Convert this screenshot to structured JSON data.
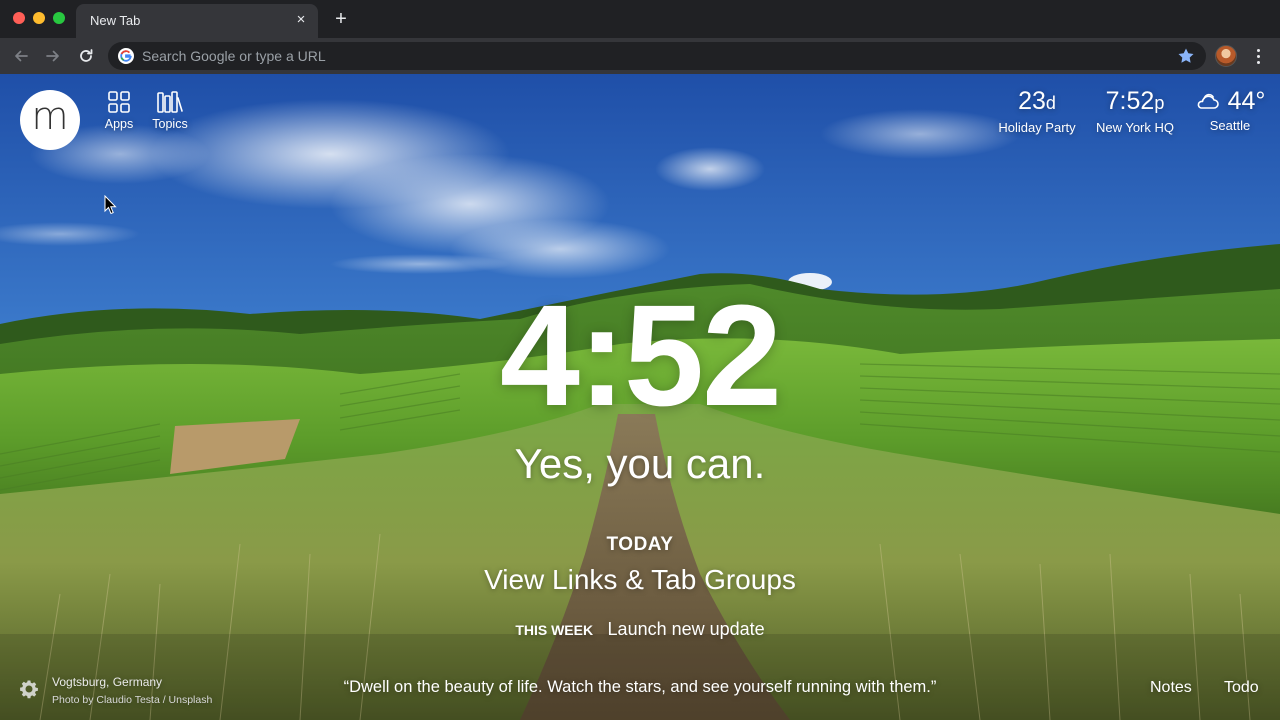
{
  "browser": {
    "tab_title": "New Tab",
    "tab_close": "×",
    "new_tab": "+",
    "omnibox_placeholder": "Search Google or type a URL"
  },
  "momentum": {
    "logo_letter": "m",
    "apps_label": "Apps",
    "topics_label": "Topics",
    "countdown": {
      "value": "23",
      "unit": "d",
      "label": "Holiday Party"
    },
    "world_clock": {
      "value": "7:52",
      "unit": "p",
      "label": "New York HQ"
    },
    "weather": {
      "value": "44°",
      "label": "Seattle",
      "icon": "partly-cloudy-icon"
    },
    "clock": "4:52",
    "mantra": "Yes, you can.",
    "today_label": "TODAY",
    "today_focus": "View Links & Tab Groups",
    "this_week_label": "THIS WEEK",
    "this_week_text": "Launch new update",
    "photo_location": "Vogtsburg, Germany",
    "photo_credit": "Photo by Claudio Testa / Unsplash",
    "quote": "“Dwell on the beauty of life. Watch the stars, and see yourself running with them.”",
    "notes_label": "Notes",
    "todo_label": "Todo"
  },
  "colors": {
    "chrome_dark": "#202124",
    "chrome_toolbar": "#35363a",
    "star_blue": "#8ab4f8"
  }
}
